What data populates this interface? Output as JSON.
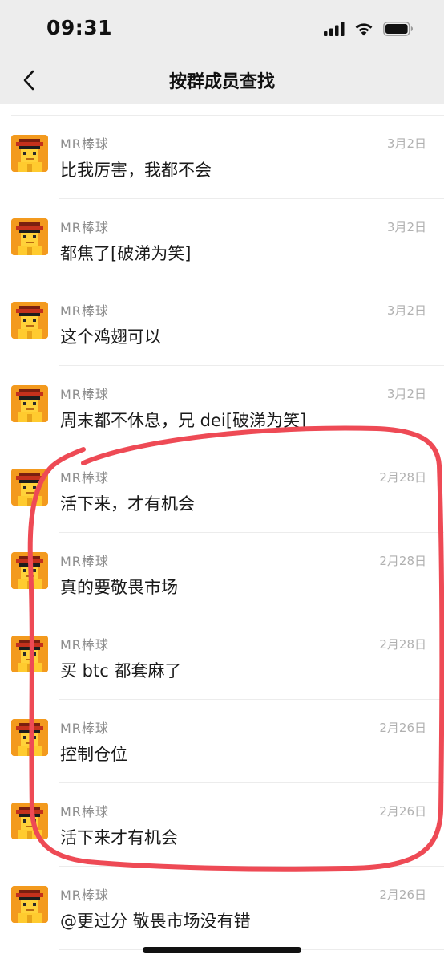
{
  "status_bar": {
    "time": "09:31",
    "icons": [
      "signal-icon",
      "wifi-icon",
      "battery-icon"
    ]
  },
  "nav": {
    "title": "按群成员查找",
    "back_icon": "chevron-left-icon"
  },
  "messages": [
    {
      "sender": "MR棒球",
      "date": "3月2日",
      "text": "比我厉害，我都不会"
    },
    {
      "sender": "MR棒球",
      "date": "3月2日",
      "text": "都焦了[破涕为笑]"
    },
    {
      "sender": "MR棒球",
      "date": "3月2日",
      "text": "这个鸡翅可以"
    },
    {
      "sender": "MR棒球",
      "date": "3月2日",
      "text": "周末都不休息，兄 dei[破涕为笑]"
    },
    {
      "sender": "MR棒球",
      "date": "2月28日",
      "text": "活下来，才有机会"
    },
    {
      "sender": "MR棒球",
      "date": "2月28日",
      "text": "真的要敬畏市场"
    },
    {
      "sender": "MR棒球",
      "date": "2月28日",
      "text": "买 btc 都套麻了"
    },
    {
      "sender": "MR棒球",
      "date": "2月26日",
      "text": "控制仓位"
    },
    {
      "sender": "MR棒球",
      "date": "2月26日",
      "text": "活下来才有机会"
    },
    {
      "sender": "MR棒球",
      "date": "2月26日",
      "text": "@更过分 敬畏市场没有错"
    }
  ],
  "colors": {
    "nav_bg": "#ededed",
    "annotation_red": "#ee4a55",
    "avatar_orange": "#f39a1e"
  }
}
